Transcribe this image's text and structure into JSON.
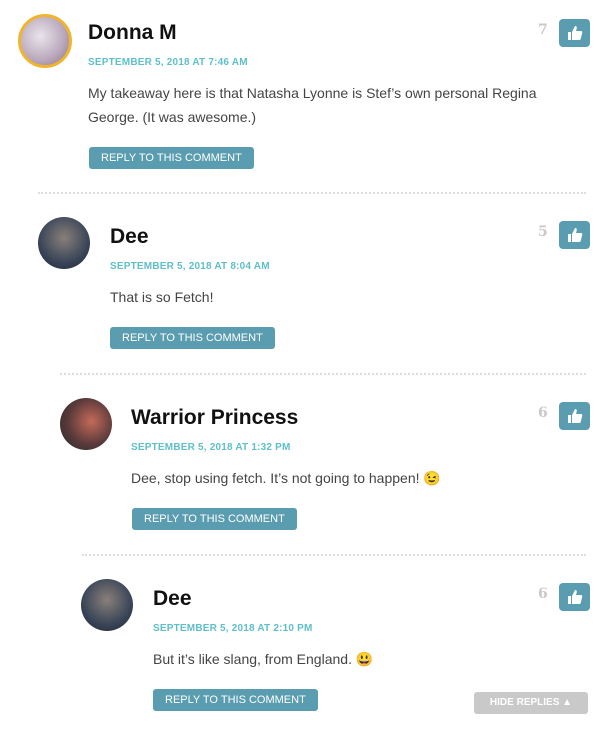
{
  "comments": [
    {
      "author": "Donna M",
      "date": "SEPTEMBER 5, 2018 AT 7:46 AM",
      "text": "My takeaway here is that Natasha Lyonne is Stef’s own personal Regina George. (It was awesome.)",
      "likes": "7",
      "reply_label": "REPLY TO THIS COMMENT",
      "avatar": "avatar-mug-photo"
    },
    {
      "author": "Dee",
      "date": "SEPTEMBER 5, 2018 AT 8:04 AM",
      "text": "That is so Fetch!",
      "likes": "5",
      "reply_label": "REPLY TO THIS COMMENT",
      "avatar": "avatar-portrait"
    },
    {
      "author": "Warrior Princess",
      "date": "SEPTEMBER 5, 2018 AT 1:32 PM",
      "text": "Dee, stop using fetch. It’s not going to happen! 😉",
      "likes": "6",
      "reply_label": "REPLY TO THIS COMMENT",
      "avatar": "avatar-two-women"
    },
    {
      "author": "Dee",
      "date": "SEPTEMBER 5, 2018 AT 2:10 PM",
      "text": "But it’s like slang, from England. 😃",
      "likes": "6",
      "reply_label": "REPLY TO THIS COMMENT",
      "avatar": "avatar-portrait"
    }
  ],
  "hide_replies_label": "HIDE REPLIES ▲",
  "colors": {
    "accent": "#5b9db0",
    "date": "#5fbfc9",
    "gold": "#f1b52d"
  }
}
